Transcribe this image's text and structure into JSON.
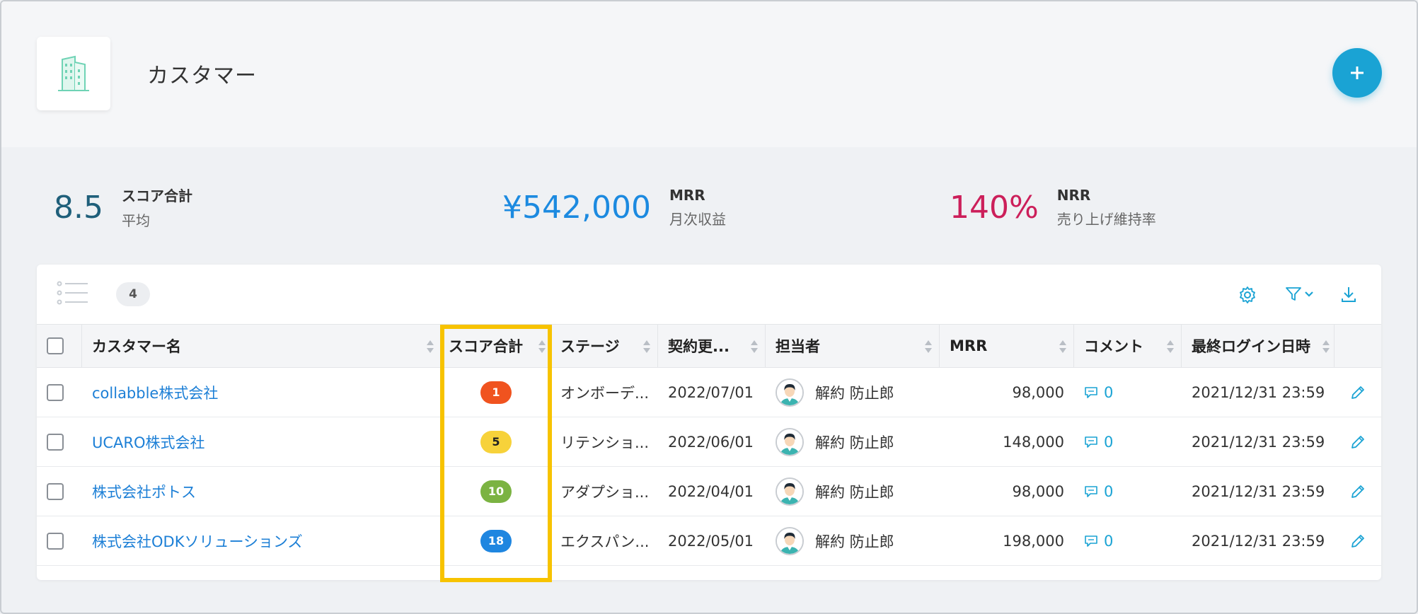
{
  "header": {
    "title": "カスタマー",
    "add_label": "+"
  },
  "stats": [
    {
      "value": "8.5",
      "label": "スコア合計",
      "sub": "平均",
      "color": "#1f5f7a"
    },
    {
      "value": "¥542,000",
      "label": "MRR",
      "sub": "月次収益",
      "color": "#1c8ae0"
    },
    {
      "value": "140%",
      "label": "NRR",
      "sub": "売り上げ維持率",
      "color": "#cc1f5a"
    }
  ],
  "toolbar": {
    "count": "4"
  },
  "columns": {
    "name": "カスタマー名",
    "score": "スコア合計",
    "stage": "ステージ",
    "contract": "契約更...",
    "owner": "担当者",
    "mrr": "MRR",
    "comment": "コメント",
    "last_login": "最終ログイン日時"
  },
  "rows": [
    {
      "name": "collabble株式会社",
      "score": "1",
      "score_color": "#f0531f",
      "score_text": "#ffffff",
      "stage": "オンボーデ...",
      "contract": "2022/07/01",
      "owner": "解約 防止郎",
      "mrr": "98,000",
      "comments": "0",
      "last_login": "2021/12/31 23:59"
    },
    {
      "name": "UCARO株式会社",
      "score": "5",
      "score_color": "#f7d23a",
      "score_text": "#222222",
      "stage": "リテンショ...",
      "contract": "2022/06/01",
      "owner": "解約 防止郎",
      "mrr": "148,000",
      "comments": "0",
      "last_login": "2021/12/31 23:59"
    },
    {
      "name": "株式会社ポトス",
      "score": "10",
      "score_color": "#7bb342",
      "score_text": "#ffffff",
      "stage": "アダプショ...",
      "contract": "2022/04/01",
      "owner": "解約 防止郎",
      "mrr": "98,000",
      "comments": "0",
      "last_login": "2021/12/31 23:59"
    },
    {
      "name": "株式会社ODKソリューションズ",
      "score": "18",
      "score_color": "#1f86e0",
      "score_text": "#ffffff",
      "stage": "エクスパン...",
      "contract": "2022/05/01",
      "owner": "解約 防止郎",
      "mrr": "198,000",
      "comments": "0",
      "last_login": "2021/12/31 23:59"
    }
  ],
  "colors": {
    "accent": "#1aa3d4",
    "link": "#1c7fd6",
    "highlight": "#f7c300"
  }
}
